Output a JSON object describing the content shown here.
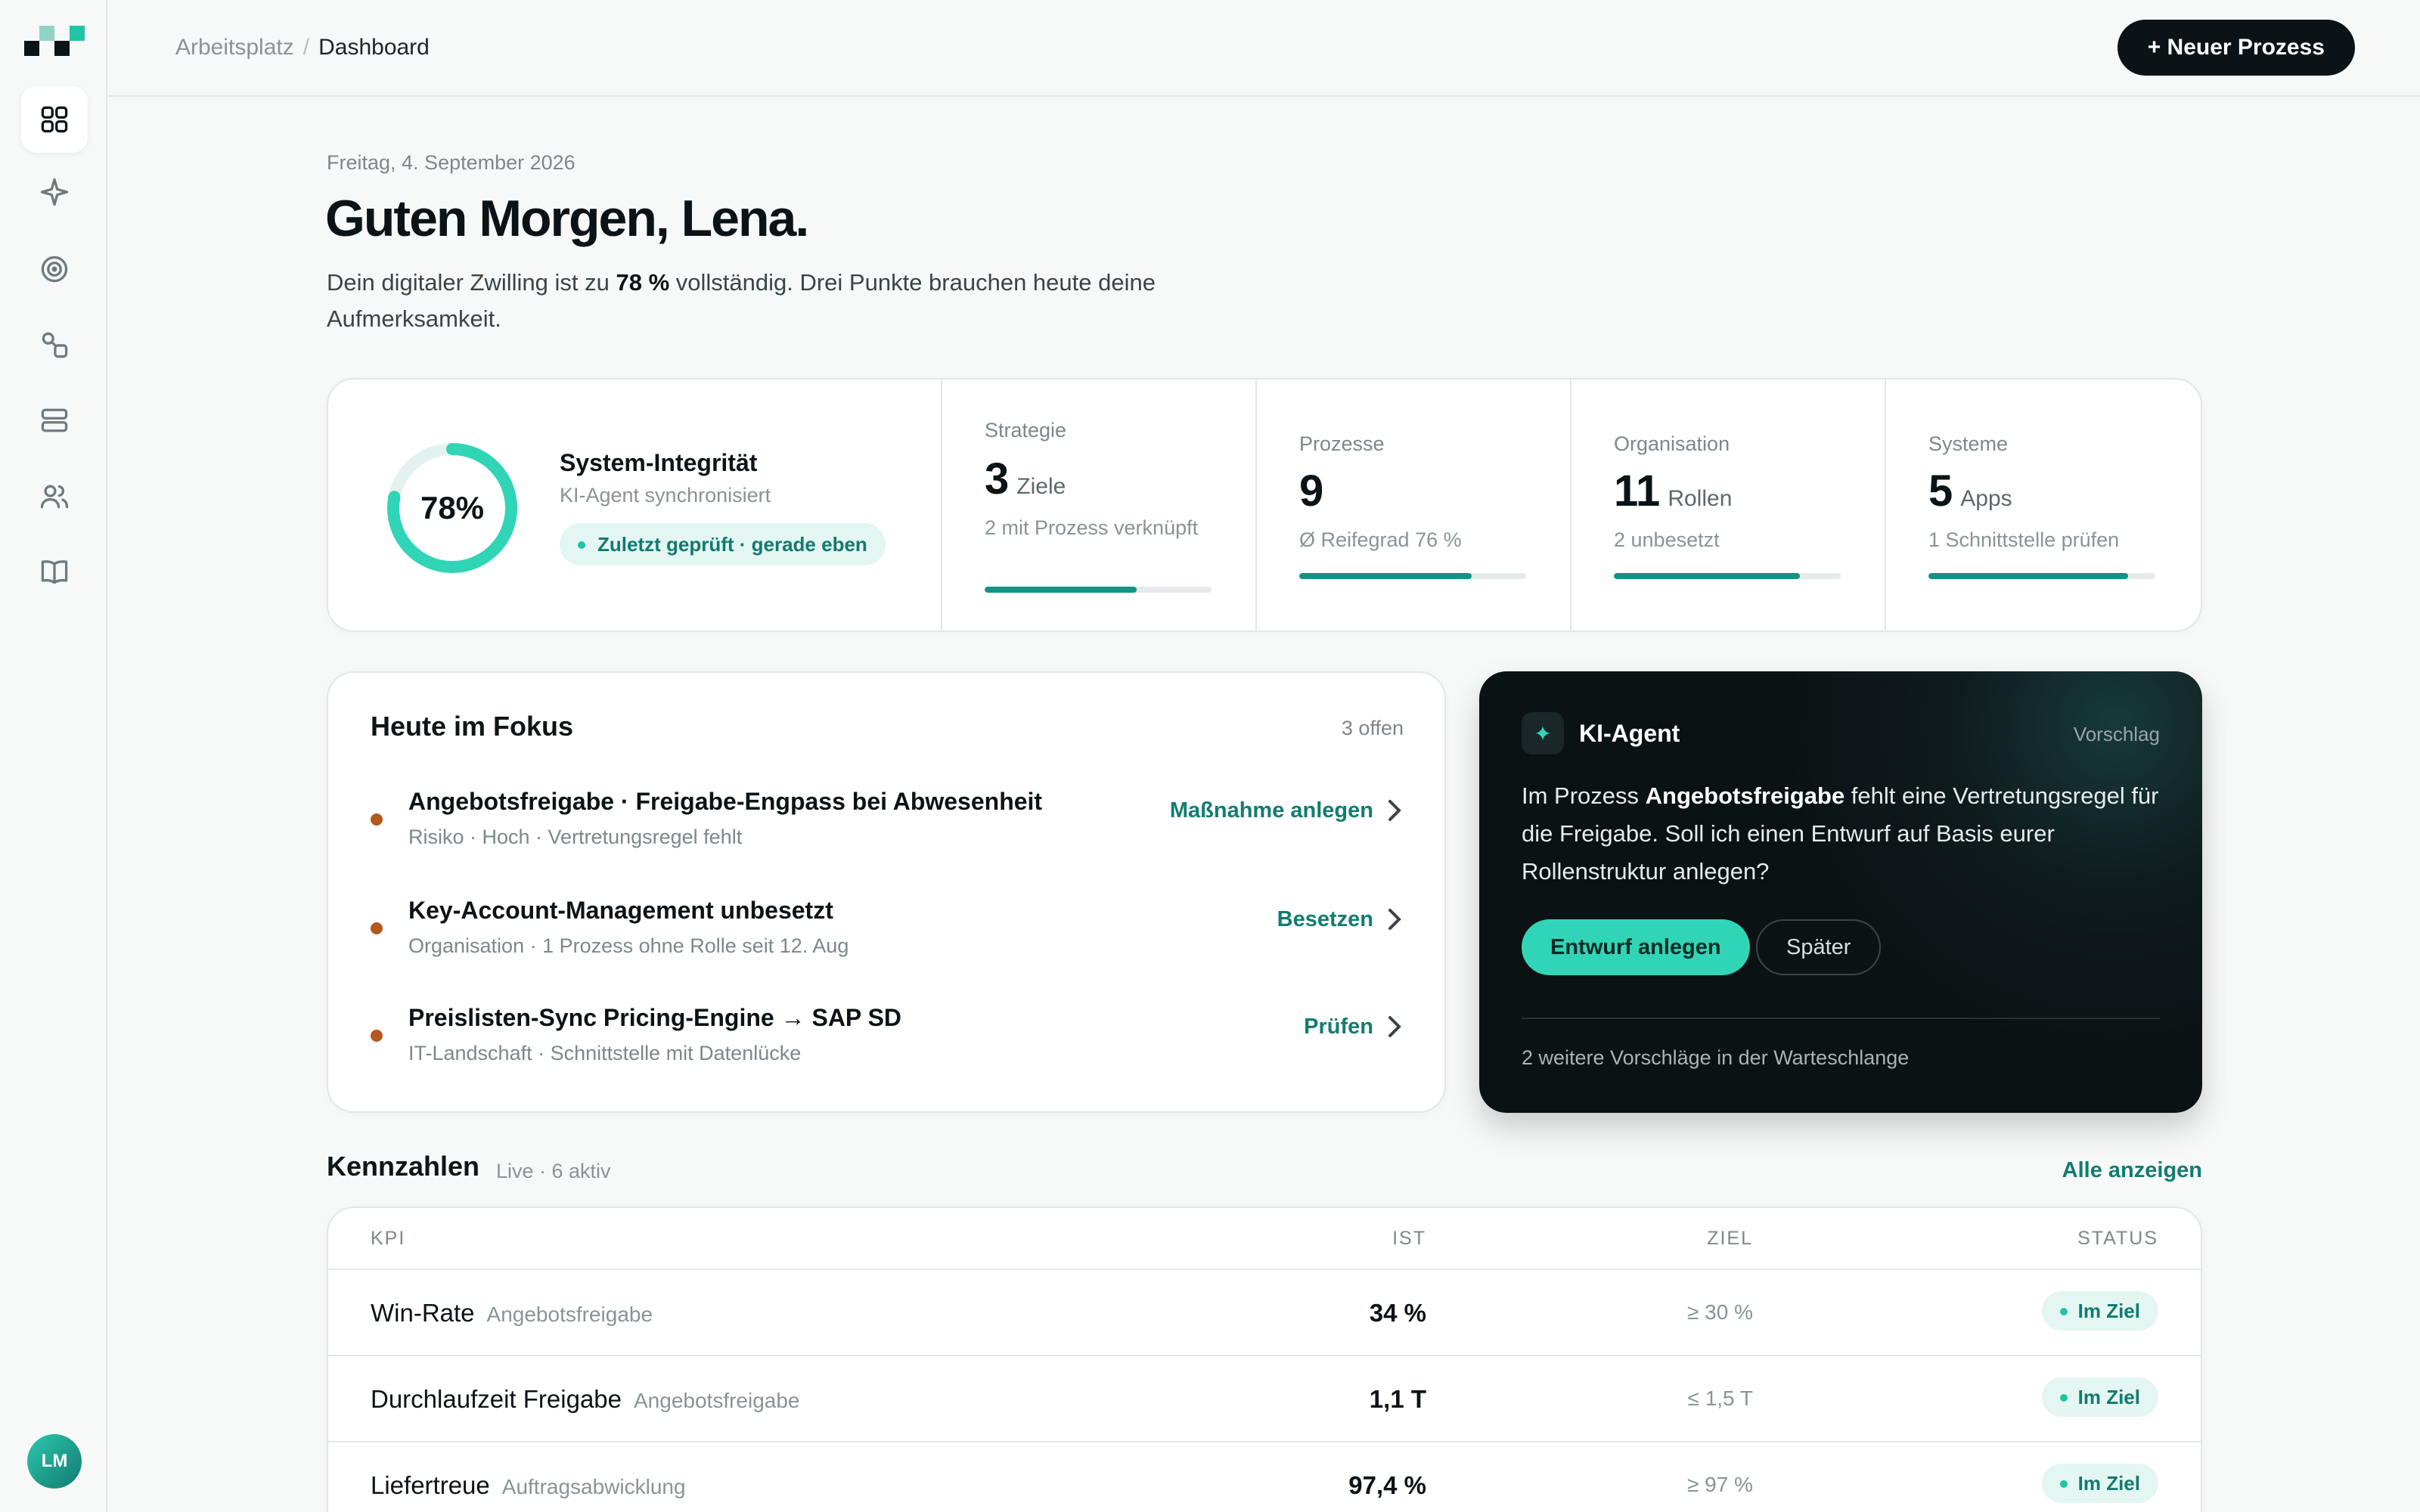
{
  "breadcrumb": {
    "root": "Arbeitsplatz",
    "separator": "/",
    "current": "Dashboard"
  },
  "header": {
    "new_process_label": "+ Neuer Prozess"
  },
  "user": {
    "initials": "LM"
  },
  "greeting": {
    "date": "Freitag, 4. September 2026",
    "title": "Guten Morgen, Lena.",
    "intro_before": "Dein digitaler Zwilling ist zu ",
    "intro_value": "78 %",
    "intro_after": " vollständig. Drei Punkte brauchen heute deine Aufmerksamkeit."
  },
  "integrity": {
    "percent_label": "78%",
    "percent": 78,
    "title": "System-Integrität",
    "subtitle": "KI-Agent synchronisiert",
    "badge": "Zuletzt geprüft · gerade eben"
  },
  "stats": [
    {
      "label": "Strategie",
      "value": "3",
      "unit": "Ziele",
      "sub": "2 mit Prozess verknüpft",
      "progress": 0.67
    },
    {
      "label": "Prozesse",
      "value": "9",
      "unit": "",
      "sub": "Ø Reifegrad 76 %",
      "progress": 0.76
    },
    {
      "label": "Organisation",
      "value": "11",
      "unit": "Rollen",
      "sub": "2 unbesetzt",
      "progress": 0.82
    },
    {
      "label": "Systeme",
      "value": "5",
      "unit": "Apps",
      "sub": "1 Schnittstelle prüfen",
      "progress": 0.88
    }
  ],
  "focus": {
    "title": "Heute im Fokus",
    "count": "3 offen",
    "items": [
      {
        "title": "Angebotsfreigabe · Freigabe-Engpass bei Abwesenheit",
        "meta": "Risiko · Hoch · Vertretungsregel fehlt",
        "action": "Maßnahme anlegen"
      },
      {
        "title": "Key-Account-Management unbesetzt",
        "meta": "Organisation · 1 Prozess ohne Rolle seit 12. Aug",
        "action": "Besetzen"
      },
      {
        "title": "Preislisten-Sync Pricing-Engine → SAP SD",
        "meta": "IT-Landschaft · Schnittstelle mit Datenlücke",
        "action": "Prüfen"
      }
    ]
  },
  "agent": {
    "icon": "sparkle-icon",
    "title": "KI-Agent",
    "tag": "Vorschlag",
    "text_before": "Im Prozess ",
    "text_bold": "Angebotsfreigabe",
    "text_after": " fehlt eine Vertretungsregel für die Freigabe. Soll ich einen Entwurf auf Basis eurer Rollenstruktur anlegen?",
    "primary": "Entwurf anlegen",
    "secondary": "Später",
    "footer": "2 weitere Vorschläge in der Warteschlange"
  },
  "kpis": {
    "title": "Kennzahlen",
    "live": "Live · 6 aktiv",
    "show_all": "Alle anzeigen",
    "columns": {
      "kpi": "KPI",
      "ist": "IST",
      "ziel": "ZIEL",
      "status": "STATUS"
    },
    "rows": [
      {
        "name": "Win-Rate",
        "process": "Angebotsfreigabe",
        "ist": "34 %",
        "ziel": "≥ 30 %",
        "status": "Im Ziel"
      },
      {
        "name": "Durchlaufzeit Freigabe",
        "process": "Angebotsfreigabe",
        "ist": "1,1 T",
        "ziel": "≤ 1,5 T",
        "status": "Im Ziel"
      },
      {
        "name": "Liefertreue",
        "process": "Auftragsabwicklung",
        "ist": "97,4 %",
        "ziel": "≥ 97 %",
        "status": "Im Ziel"
      }
    ]
  },
  "colors": {
    "accent": "#139383",
    "accent_light": "#2fd5b6",
    "risk_dot": "#b4581c",
    "dark_card": "#0b1214"
  }
}
